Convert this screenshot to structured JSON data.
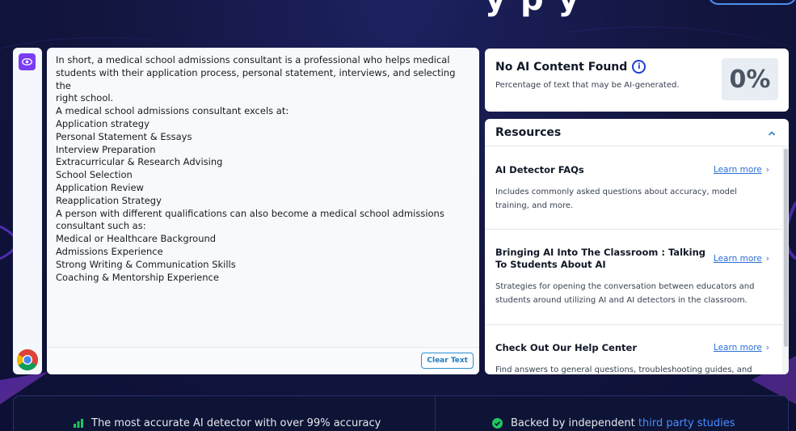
{
  "editor": {
    "lines": [
      "In short, a medical school admissions consultant is a professional who helps medical",
      "students with their application process, personal statement, interviews, and selecting the",
      "right school.",
      "A medical school admissions consultant excels at:",
      "Application strategy",
      "Personal Statement & Essays",
      "Interview Preparation",
      "Extracurricular & Research Advising",
      "School Selection",
      "Application Review",
      "Reapplication Strategy",
      "A person with different qualifications can also become a medical school admissions",
      "consultant such as:",
      "Medical or Healthcare Background",
      "Admissions Experience",
      "Strong Writing & Communication Skills",
      "Coaching & Mentorship Experience"
    ],
    "clear_label": "Clear Text"
  },
  "result": {
    "title": "No AI Content Found",
    "subtitle": "Percentage of text that may be AI-generated.",
    "percent": "0%"
  },
  "resources": {
    "title": "Resources",
    "items": [
      {
        "title": "AI Detector FAQs",
        "link": "Learn more",
        "desc": "Includes commonly asked questions about accuracy, model training, and more."
      },
      {
        "title": "Bringing AI Into The Classroom : Talking To Students About AI",
        "link": "Learn more",
        "desc": "Strategies for opening the conversation between educators and students around utilizing AI and AI detectors in the classroom."
      },
      {
        "title": "Check Out Our Help Center",
        "link": "Learn more",
        "desc": "Find answers to general questions, troubleshooting guides, and"
      }
    ]
  },
  "features": {
    "left": "The most accurate AI detector with over 99% accuracy",
    "right_prefix": "Backed by independent",
    "right_link": "third party studies"
  },
  "colors": {
    "accent_purple": "#7b3cf5",
    "link_blue": "#2a6fd6",
    "feature_green": "#22c55e",
    "background": "#12153d"
  },
  "icons": [
    "eye-icon",
    "chrome-icon",
    "info-icon",
    "chevron-up-icon",
    "chevron-right-icon",
    "bar-chart-icon",
    "check-circle-icon"
  ]
}
